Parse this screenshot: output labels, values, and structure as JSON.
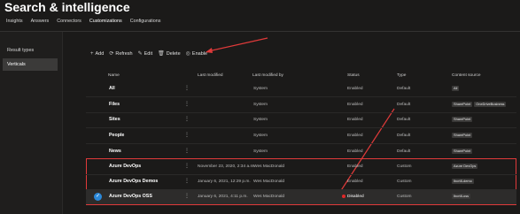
{
  "app": {
    "title": "Search & intelligence"
  },
  "tabs": [
    {
      "label": "Insights"
    },
    {
      "label": "Answers"
    },
    {
      "label": "Connectors"
    },
    {
      "label": "Customizations",
      "active": true
    },
    {
      "label": "Configurations"
    }
  ],
  "sidebar": {
    "items": [
      {
        "label": "Result types"
      },
      {
        "label": "Verticals",
        "selected": true
      }
    ]
  },
  "toolbar": {
    "add": "Add",
    "refresh": "Refresh",
    "edit": "Edit",
    "delete": "Delete",
    "enable": "Enable"
  },
  "table": {
    "columns": [
      "Name",
      "Last modified",
      "Last modified by",
      "Status",
      "Type",
      "Content source"
    ],
    "rows": [
      {
        "name": "All",
        "last_modified": "",
        "by": "System",
        "status": "Enabled",
        "type": "Default",
        "sources": [
          "All"
        ]
      },
      {
        "name": "Files",
        "last_modified": "",
        "by": "System",
        "status": "Enabled",
        "type": "Default",
        "sources": [
          "SharePoint",
          "OneDriveBusiness"
        ]
      },
      {
        "name": "Sites",
        "last_modified": "",
        "by": "System",
        "status": "Enabled",
        "type": "Default",
        "sources": [
          "SharePoint"
        ]
      },
      {
        "name": "People",
        "last_modified": "",
        "by": "System",
        "status": "Enabled",
        "type": "Default",
        "sources": [
          "SharePoint"
        ]
      },
      {
        "name": "News",
        "last_modified": "",
        "by": "System",
        "status": "Enabled",
        "type": "Default",
        "sources": [
          "SharePoint"
        ]
      },
      {
        "name": "Azure DevOps",
        "last_modified": "November 23, 2020, 2:34 a.m.",
        "by": "Wes MacDonald",
        "status": "Enabled",
        "type": "Custom",
        "sources": [
          "Azure DevOps"
        ]
      },
      {
        "name": "Azure DevOps Demos",
        "last_modified": "January 6, 2021, 12:29 p.m.",
        "by": "Wes MacDonald",
        "status": "Enabled",
        "type": "Custom",
        "sources": [
          "Ibcrt8-demo"
        ]
      },
      {
        "name": "Azure DevOps OSS",
        "last_modified": "January 6, 2021, 4:11 p.m.",
        "by": "Wes MacDonald",
        "status": "Disabled",
        "type": "Custom",
        "sources": [
          "Ibcrt8-oss"
        ]
      }
    ]
  },
  "colors": {
    "accent": "#2b88d8",
    "annotation": "#e03a3a",
    "disabled_dot": "#e02828"
  }
}
